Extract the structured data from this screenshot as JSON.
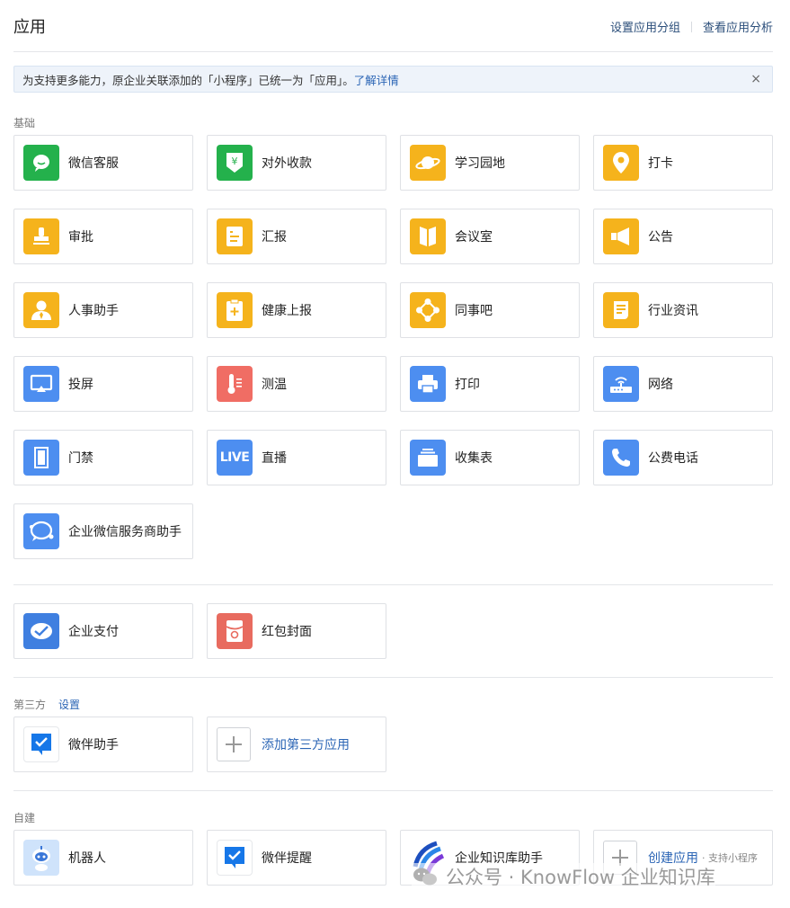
{
  "header": {
    "title": "应用",
    "link_group": "设置应用分组",
    "link_analysis": "查看应用分析"
  },
  "notice": {
    "text": "为支持更多能力，原企业关联添加的「小程序」已统一为「应用」。",
    "link": "了解详情",
    "close": "×"
  },
  "sections": {
    "basic": "基础",
    "third_party": "第三方",
    "third_party_settings": "设置",
    "self_built": "自建"
  },
  "basic_apps": [
    {
      "label": "微信客服",
      "icon": "chat-bubble-icon",
      "color": "#24b14c"
    },
    {
      "label": "对外收款",
      "icon": "yuan-shield-icon",
      "color": "#24b14c"
    },
    {
      "label": "学习园地",
      "icon": "planet-icon",
      "color": "#f5b31c"
    },
    {
      "label": "打卡",
      "icon": "location-pin-icon",
      "color": "#f5b31c"
    },
    {
      "label": "审批",
      "icon": "stamp-icon",
      "color": "#f5b31c"
    },
    {
      "label": "汇报",
      "icon": "report-doc-icon",
      "color": "#f5b31c"
    },
    {
      "label": "会议室",
      "icon": "door-icon",
      "color": "#f5b31c"
    },
    {
      "label": "公告",
      "icon": "megaphone-icon",
      "color": "#f5b31c"
    },
    {
      "label": "人事助手",
      "icon": "person-icon",
      "color": "#f5b31c"
    },
    {
      "label": "健康上报",
      "icon": "health-clipboard-icon",
      "color": "#f5b31c"
    },
    {
      "label": "同事吧",
      "icon": "network-nodes-icon",
      "color": "#f5b31c"
    },
    {
      "label": "行业资讯",
      "icon": "news-scroll-icon",
      "color": "#f5b31c"
    },
    {
      "label": "投屏",
      "icon": "screencast-icon",
      "color": "#4d8ef0"
    },
    {
      "label": "测温",
      "icon": "thermometer-icon",
      "color": "#f06d64"
    },
    {
      "label": "打印",
      "icon": "printer-icon",
      "color": "#4d8ef0"
    },
    {
      "label": "网络",
      "icon": "router-icon",
      "color": "#4d8ef0"
    },
    {
      "label": "门禁",
      "icon": "access-door-icon",
      "color": "#4d8ef0"
    },
    {
      "label": "直播",
      "icon": "live-icon",
      "color": "#4d8ef0",
      "icon_text": "LIVE"
    },
    {
      "label": "收集表",
      "icon": "form-tray-icon",
      "color": "#4d8ef0"
    },
    {
      "label": "公费电话",
      "icon": "phone-icon",
      "color": "#4d8ef0"
    },
    {
      "label": "企业微信服务商助手",
      "icon": "service-chat-icon",
      "color": "#4d8ef0"
    }
  ],
  "pay_apps": [
    {
      "label": "企业支付",
      "icon": "payment-check-icon",
      "color": "#4d8ef0"
    },
    {
      "label": "红包封面",
      "icon": "red-envelope-icon",
      "color": "#f06d64"
    }
  ],
  "third_party_apps": {
    "weiban": "微伴助手",
    "add": "添加第三方应用"
  },
  "self_built_apps": {
    "robot": "机器人",
    "reminder": "微伴提醒",
    "knowledge": "企业知识库助手",
    "create": "创建应用",
    "create_sub": "· 支持小程序"
  },
  "watermark": "公众号 · KnowFlow 企业知识库"
}
